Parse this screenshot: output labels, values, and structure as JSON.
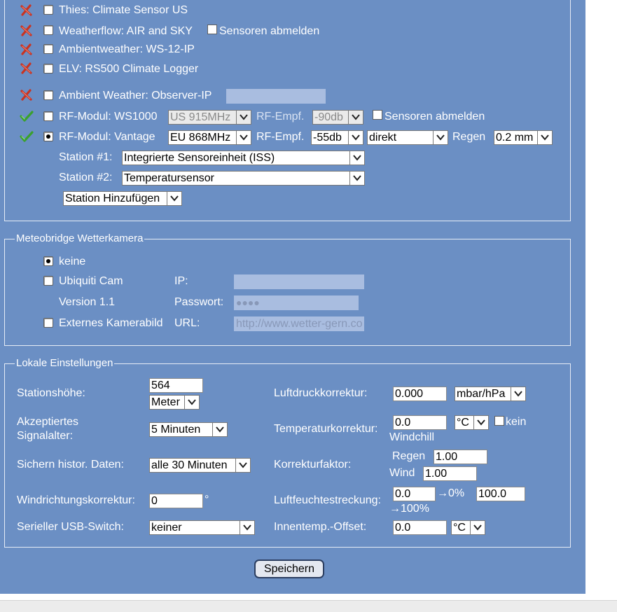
{
  "sensors": [
    {
      "status": "unavailable",
      "label": "Thies: Climate Sensor US"
    },
    {
      "status": "unavailable",
      "label": "Weatherflow: AIR and SKY",
      "checkbox_label": "Sensoren abmelden"
    },
    {
      "status": "unavailable",
      "label": "Ambientweather: WS-12-IP"
    },
    {
      "status": "unavailable",
      "label": "ELV: RS500 Climate Logger"
    },
    {
      "status": "unavailable",
      "label": "Ambient Weather: Observer-IP"
    },
    {
      "status": "available",
      "label": "RF-Modul: WS1000",
      "freq": "US 915MHz",
      "rf_label": "RF-Empf.",
      "rf": "-90db",
      "checkbox_label": "Sensoren abmelden"
    },
    {
      "status": "available",
      "label": "RF-Modul: Vantage",
      "freq": "EU 868MHz",
      "rf_label": "RF-Empf.",
      "rf": "-55db",
      "mode": "direkt",
      "rain_label": "Regen",
      "rain": "0.2 mm"
    }
  ],
  "stations": [
    {
      "label": "Station #1:",
      "value": "Integrierte Sensoreinheit (ISS)"
    },
    {
      "label": "Station #2:",
      "value": "Temperatursensor"
    }
  ],
  "add_station": "Station Hinzufügen",
  "camera": {
    "legend": "Meteobridge Wetterkamera",
    "none": "keine",
    "ubiquiti": "Ubiquiti Cam",
    "version": "Version 1.1",
    "ip_label": "IP:",
    "password_label": "Passwort:",
    "password_value": "●●●●",
    "external": "Externes Kamerabild",
    "url_label": "URL:",
    "url_value": "http://www.wetter-gern.co"
  },
  "local": {
    "legend": "Lokale Einstellungen",
    "altitude_label": "Stationshöhe:",
    "altitude_value": "564",
    "altitude_unit": "Meter",
    "signal_label_1": "Akzeptiertes",
    "signal_label_2": "Signalalter:",
    "signal_value": "5 Minuten",
    "history_label": "Sichern histor. Daten:",
    "history_value": "alle 30 Minuten",
    "wind_dir_label": "Windrichtungskorrektur:",
    "wind_dir_value": "0",
    "wind_dir_unit": "°",
    "usb_label": "Serieller USB-Switch:",
    "usb_value": "keiner",
    "pressure_label": "Luftdruckkorrektur:",
    "pressure_value": "0.000",
    "pressure_unit": "mbar/hPa",
    "temp_label": "Temperaturkorrektur:",
    "temp_value": "0.0",
    "temp_unit": "°C",
    "no_windchill_1": "kein",
    "no_windchill_2": "Windchill",
    "factor_label": "Korrekturfaktor:",
    "rain_label": "Regen",
    "rain_value": "1.00",
    "wind_label": "Wind",
    "wind_value": "1.00",
    "humidity_label": "Luftfeuchtestreckung:",
    "humidity_low": "0.0",
    "humidity_low_suffix": "→0%",
    "humidity_high": "100.0",
    "humidity_high_suffix": "→100%",
    "indoor_label": "Innentemp.-Offset:",
    "indoor_value": "0.0",
    "indoor_unit": "°C"
  },
  "save_button": "Speichern",
  "colors": {
    "panel": "#6b8fc4",
    "unavailable": "#d63a2a",
    "available": "#3aa02e"
  }
}
